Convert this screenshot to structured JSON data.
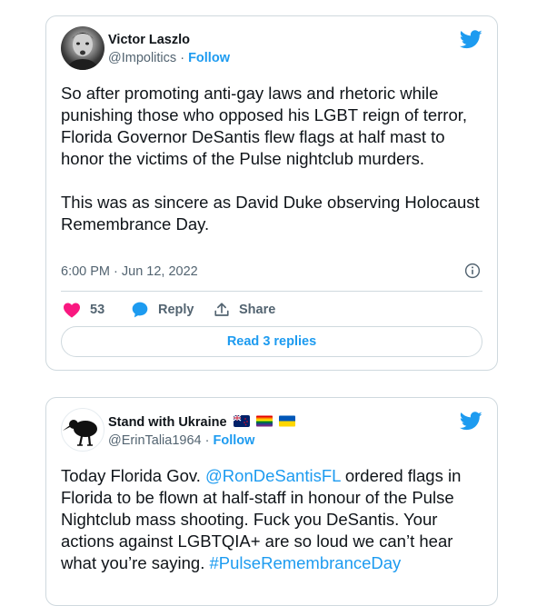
{
  "tweets": [
    {
      "author_name": "Victor Laszlo",
      "handle": "@Impolitics",
      "separator": "·",
      "follow_label": "Follow",
      "text_para1": "So after promoting anti-gay laws and rhetoric while punishing those who opposed his LGBT reign of terror, Florida Governor DeSantis flew flags at half mast to honor the victims of the Pulse nightclub murders.",
      "text_para2": "This was as sincere as David Duke observing Holocaust Remembrance Day.",
      "timestamp": "6:00 PM · Jun 12, 2022",
      "like_count": "53",
      "reply_label": "Reply",
      "share_label": "Share",
      "read_replies_label": "Read 3 replies",
      "avatar_icon": "portrait-photo",
      "like_icon": "heart-icon",
      "reply_icon": "speech-bubble-icon",
      "share_icon": "share-arrow-icon",
      "info_icon": "info-icon"
    },
    {
      "author_name": "Stand with Ukraine",
      "author_emojis": [
        "new-zealand-flag",
        "rainbow-flag",
        "ukraine-flag"
      ],
      "handle": "@ErinTalia1964",
      "separator": "·",
      "follow_label": "Follow",
      "text_before_mention": "Today Florida Gov. ",
      "mention": "@RonDeSantisFL",
      "text_after_mention": " ordered flags in Florida to be flown at half-staff in honour of the Pulse Nightclub mass shooting. Fuck you DeSantis. Your actions against LGBTQIA+ are so loud we can’t hear what you’re saying. ",
      "hashtag": "#PulseRemembranceDay",
      "avatar_icon": "kiwi-bird-silhouette"
    }
  ],
  "brand_icon": "twitter-bird-icon",
  "colors": {
    "accent": "#1d9bf0",
    "like": "#f91880",
    "text": "#0f1419",
    "secondary_text": "#536471",
    "border": "#cfd9de"
  }
}
